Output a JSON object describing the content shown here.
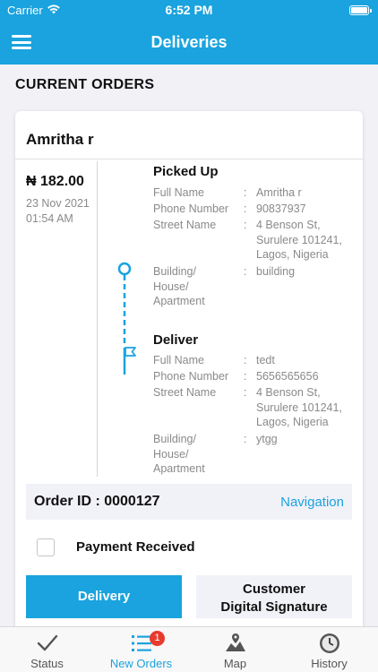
{
  "status_bar": {
    "carrier": "Carrier",
    "time": "6:52 PM"
  },
  "header": {
    "title": "Deliveries"
  },
  "section_title": "CURRENT ORDERS",
  "order": {
    "customer_name": "Amritha r",
    "price": "₦ 182.00",
    "date": "23 Nov 2021 01:54 AM",
    "pickup": {
      "title": "Picked Up",
      "fields": [
        {
          "label": "Full Name",
          "value": "Amritha r"
        },
        {
          "label": "Phone Number",
          "value": "90837937"
        },
        {
          "label": "Street Name",
          "value": "4 Benson St, Surulere 101241, Lagos, Nigeria"
        },
        {
          "label": "Building/ House/ Apartment",
          "value": "building"
        }
      ]
    },
    "deliver": {
      "title": "Deliver",
      "fields": [
        {
          "label": "Full Name",
          "value": "tedt"
        },
        {
          "label": "Phone Number",
          "value": "5656565656"
        },
        {
          "label": "Street Name",
          "value": "4 Benson St, Surulere 101241, Lagos, Nigeria"
        },
        {
          "label": "Building/ House/ Apartment",
          "value": "ytgg"
        }
      ]
    },
    "separator": ":",
    "order_id": "Order ID : 0000127",
    "navigation_label": "Navigation",
    "payment_label": "Payment Received",
    "payment_checked": false,
    "delivery_button": "Delivery",
    "signature_button_line1": "Customer",
    "signature_button_line2": "Digital Signature"
  },
  "tabs": [
    {
      "label": "Status",
      "icon": "checkmark-icon"
    },
    {
      "label": "New Orders",
      "icon": "list-icon",
      "badge": "1",
      "active": true
    },
    {
      "label": "Map",
      "icon": "map-icon"
    },
    {
      "label": "History",
      "icon": "clock-icon"
    }
  ],
  "colors": {
    "accent": "#1aa3de",
    "badge": "#e63b2e",
    "muted_text": "#8a8a8a"
  }
}
